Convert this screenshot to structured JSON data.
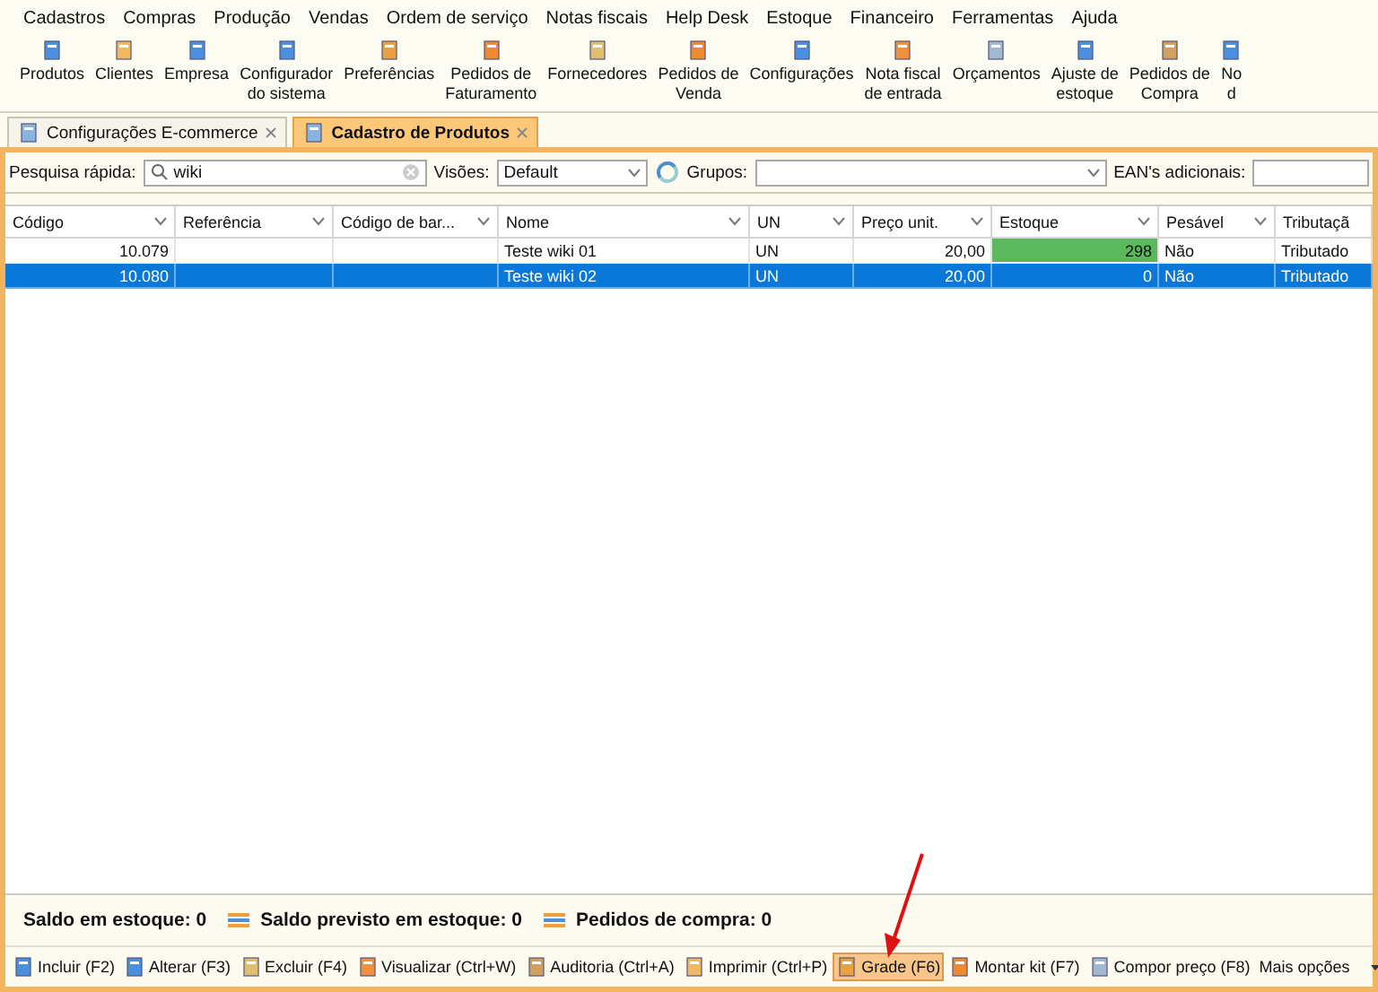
{
  "menu": [
    "Cadastros",
    "Compras",
    "Produção",
    "Vendas",
    "Ordem de serviço",
    "Notas fiscais",
    "Help Desk",
    "Estoque",
    "Financeiro",
    "Ferramentas",
    "Ajuda"
  ],
  "toolbar": [
    {
      "lines": [
        "Produtos"
      ]
    },
    {
      "lines": [
        "Clientes"
      ]
    },
    {
      "lines": [
        "Empresa"
      ]
    },
    {
      "lines": [
        "Configurador",
        "do sistema"
      ]
    },
    {
      "lines": [
        "Preferências"
      ]
    },
    {
      "lines": [
        "Pedidos de",
        "Faturamento"
      ]
    },
    {
      "lines": [
        "Fornecedores"
      ]
    },
    {
      "lines": [
        "Pedidos de",
        "Venda"
      ]
    },
    {
      "lines": [
        "Configurações"
      ]
    },
    {
      "lines": [
        "Nota fiscal",
        "de entrada"
      ]
    },
    {
      "lines": [
        "Orçamentos"
      ]
    },
    {
      "lines": [
        "Ajuste de",
        "estoque"
      ]
    },
    {
      "lines": [
        "Pedidos de",
        "Compra"
      ]
    },
    {
      "lines": [
        "No",
        "d"
      ]
    }
  ],
  "tabs": [
    {
      "label": "Configurações E-commerce",
      "selected": false
    },
    {
      "label": "Cadastro de Produtos",
      "selected": true
    }
  ],
  "filters": {
    "quick_search_label": "Pesquisa rápida:",
    "quick_search_value": "wiki",
    "views_label": "Visões:",
    "views_value": "Default",
    "groups_label": "Grupos:",
    "ean_label": "EAN's adicionais:"
  },
  "table": {
    "columns": [
      "Código",
      "Referência",
      "Código de bar...",
      "Nome",
      "UN",
      "Preço unit.",
      "Estoque",
      "Pesável",
      "Tributaçã"
    ],
    "rows": [
      {
        "cells": [
          "10.079",
          "",
          "",
          "Teste wiki 01",
          "UN",
          "20,00",
          "298",
          "Não",
          "Tributado"
        ],
        "selected": false,
        "color": "#5cb85c"
      },
      {
        "cells": [
          "10.080",
          "",
          "",
          "Teste wiki 02",
          "UN",
          "20,00",
          "0",
          "Não",
          "Tributado"
        ],
        "selected": true
      }
    ]
  },
  "summary": [
    "Saldo em estoque: 0",
    "Saldo previsto em estoque: 0",
    "Pedidos de compra: 0"
  ],
  "actions": [
    {
      "label": "Incluir (F2)",
      "highlighted": false
    },
    {
      "label": "Alterar (F3)",
      "highlighted": false
    },
    {
      "label": "Excluir (F4)",
      "highlighted": false
    },
    {
      "label": "Visualizar (Ctrl+W)",
      "highlighted": false
    },
    {
      "label": "Auditoria (Ctrl+A)",
      "highlighted": false
    },
    {
      "label": "Imprimir (Ctrl+P)",
      "highlighted": false
    },
    {
      "label": "Grade (F6)",
      "highlighted": true
    },
    {
      "label": "Montar kit (F7)",
      "highlighted": false
    },
    {
      "label": "Compor preço (F8)",
      "highlighted": false
    },
    {
      "label": "Mais opções",
      "highlighted": false
    }
  ]
}
